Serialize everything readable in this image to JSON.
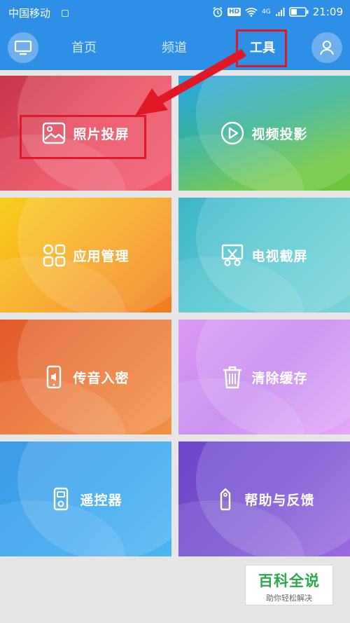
{
  "status_bar": {
    "carrier": "中国移动",
    "hd": "HD",
    "network": "4G",
    "time": "21:09"
  },
  "nav": {
    "tabs": [
      {
        "label": "首页"
      },
      {
        "label": "频道"
      },
      {
        "label": "工具",
        "active": true
      }
    ],
    "left_icon": "tv-icon",
    "right_icon": "user-icon"
  },
  "tools": [
    {
      "label": "照片投屏",
      "icon": "image-icon"
    },
    {
      "label": "视频投影",
      "icon": "play-icon"
    },
    {
      "label": "应用管理",
      "icon": "apps-icon"
    },
    {
      "label": "电视截屏",
      "icon": "screenshot-icon"
    },
    {
      "label": "传音入密",
      "icon": "phone-sound-icon"
    },
    {
      "label": "清除缓存",
      "icon": "trash-icon"
    },
    {
      "label": "遥控器",
      "icon": "remote-icon"
    },
    {
      "label": "帮助与反馈",
      "icon": "tag-icon"
    }
  ],
  "annotation_color": "#e01825",
  "watermark": {
    "title": "百科全说",
    "subtitle": "助你轻松解决"
  }
}
